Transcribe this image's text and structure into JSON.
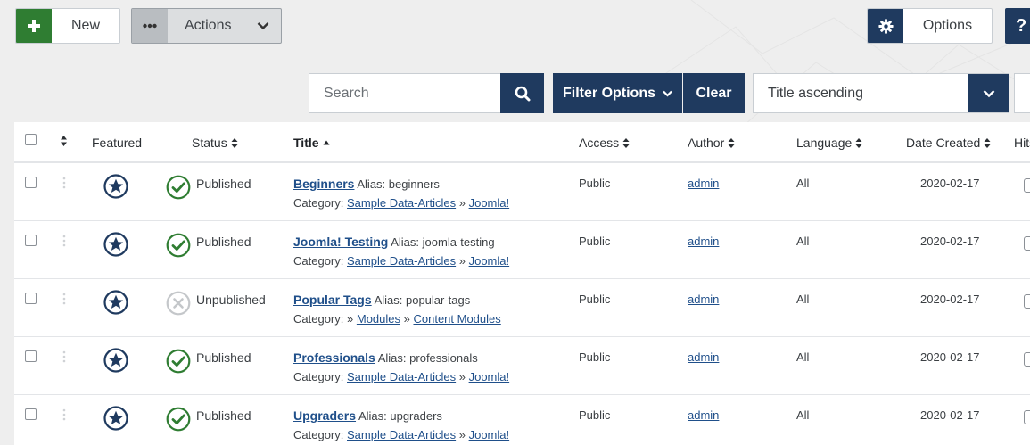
{
  "toolbar": {
    "new_label": "New",
    "actions_label": "Actions",
    "options_label": "Options",
    "help_label": "?"
  },
  "filters": {
    "search_placeholder": "Search",
    "filter_options_label": "Filter Options",
    "clear_label": "Clear",
    "sort_value": "Title ascending"
  },
  "table": {
    "headers": {
      "featured": "Featured",
      "status": "Status",
      "title": "Title",
      "access": "Access",
      "author": "Author",
      "language": "Language",
      "date_created": "Date Created",
      "hits": "Hits"
    },
    "category_prefix": "Category:",
    "alias_prefix": "Alias:",
    "rows": [
      {
        "status": "Published",
        "published": true,
        "title": "Beginners",
        "alias": "beginners",
        "cat_parent": "Sample Data-Articles",
        "sep": "»",
        "cat_child": "Joomla!",
        "access": "Public",
        "author": "admin",
        "language": "All",
        "date": "2020-02-17"
      },
      {
        "status": "Published",
        "published": true,
        "title": "Joomla! Testing",
        "alias": "joomla-testing",
        "cat_parent": "Sample Data-Articles",
        "sep": "»",
        "cat_child": "Joomla!",
        "access": "Public",
        "author": "admin",
        "language": "All",
        "date": "2020-02-17"
      },
      {
        "status": "Unpublished",
        "published": false,
        "title": "Popular Tags",
        "alias": "popular-tags",
        "cat_parent": "Modules",
        "sep": "»",
        "cat_child": "Content Modules",
        "cat_lead": "»",
        "access": "Public",
        "author": "admin",
        "language": "All",
        "date": "2020-02-17"
      },
      {
        "status": "Published",
        "published": true,
        "title": "Professionals",
        "alias": "professionals",
        "cat_parent": "Sample Data-Articles",
        "sep": "»",
        "cat_child": "Joomla!",
        "access": "Public",
        "author": "admin",
        "language": "All",
        "date": "2020-02-17"
      },
      {
        "status": "Published",
        "published": true,
        "title": "Upgraders",
        "alias": "upgraders",
        "cat_parent": "Sample Data-Articles",
        "sep": "»",
        "cat_child": "Joomla!",
        "access": "Public",
        "author": "admin",
        "language": "All",
        "date": "2020-02-17"
      }
    ]
  },
  "colors": {
    "primary": "#1f3a5f",
    "success": "#2f7d32",
    "link": "#1f4f8a",
    "unpublished": "#b5b9bd"
  }
}
